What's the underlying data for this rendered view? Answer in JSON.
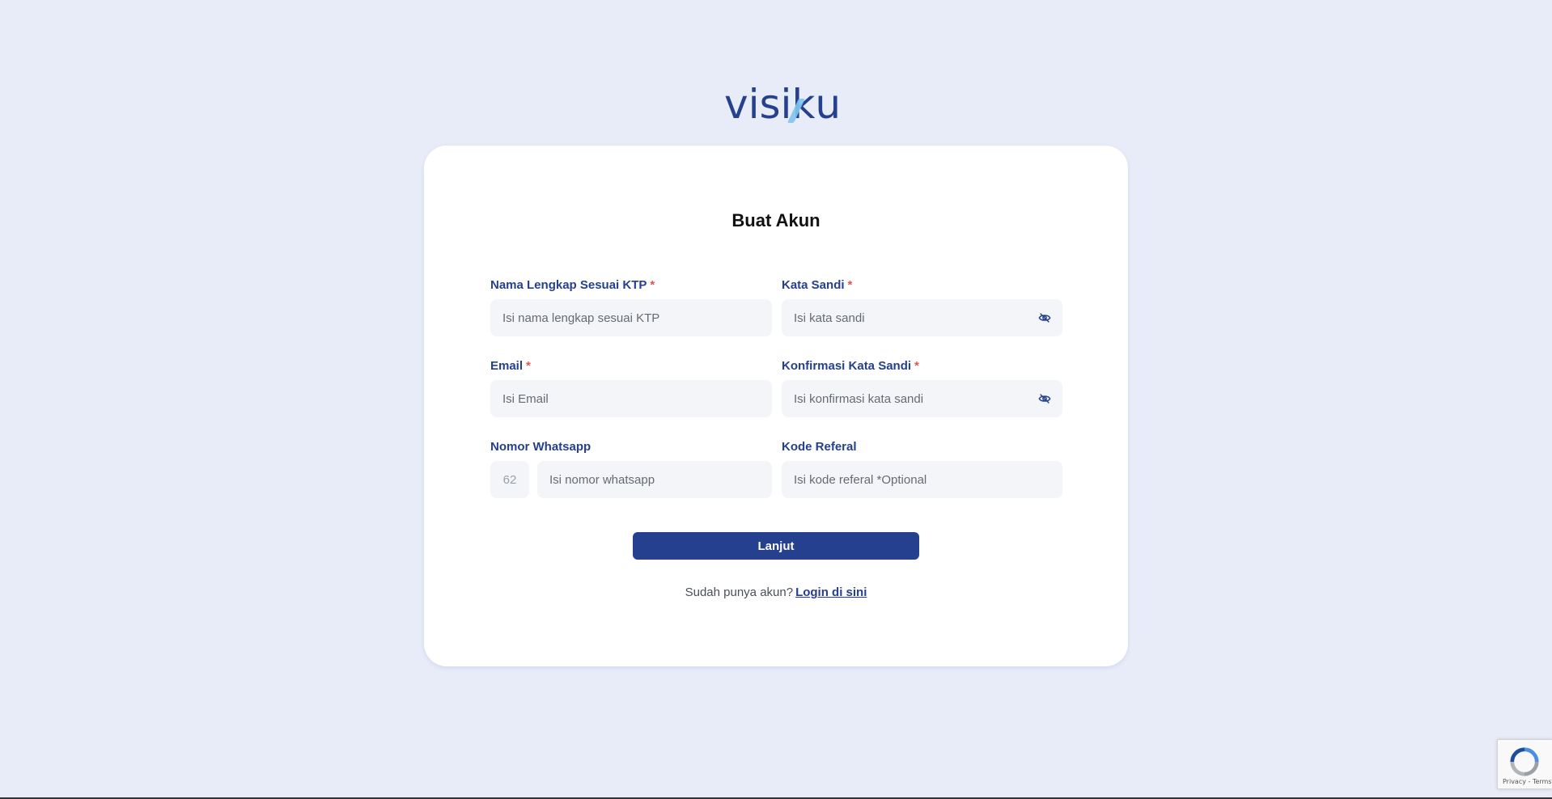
{
  "logo": {
    "pre": "visi",
    "k": "k",
    "post": "u"
  },
  "form": {
    "title": "Buat Akun",
    "fields": {
      "nama": {
        "label": "Nama Lengkap Sesuai KTP",
        "required": "*",
        "placeholder": "Isi nama lengkap sesuai KTP"
      },
      "sandi": {
        "label": "Kata Sandi",
        "required": "*",
        "placeholder": "Isi kata sandi"
      },
      "email": {
        "label": "Email",
        "required": "*",
        "placeholder": "Isi Email"
      },
      "konfirmasi": {
        "label": "Konfirmasi Kata Sandi",
        "required": "*",
        "placeholder": "Isi konfirmasi kata sandi"
      },
      "whatsapp": {
        "label": "Nomor Whatsapp",
        "prefix": "62",
        "placeholder": "Isi nomor whatsapp"
      },
      "referal": {
        "label": "Kode Referal",
        "placeholder": "Isi kode referal *Optional"
      }
    },
    "submit_label": "Lanjut",
    "footer": {
      "text": "Sudah punya akun?",
      "link": "Login di sini"
    }
  },
  "recaptcha": {
    "terms": "Privacy - Terms"
  },
  "colors": {
    "primary": "#25408f",
    "required": "#e0564f",
    "background": "#e8ecf9"
  },
  "icons": {
    "eye_toggle": "eye-off-icon",
    "recaptcha": "recaptcha-icon"
  }
}
